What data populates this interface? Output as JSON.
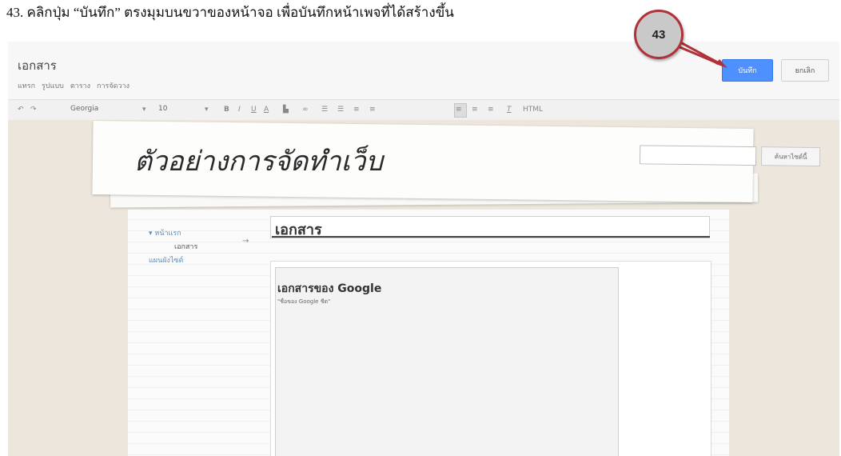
{
  "instruction": "43. คลิกปุ่ม “บันทึก” ตรงมุมบนขวาของหน้าจอ เพื่อบันทึกหน้าเพจที่ได้สร้างขึ้น",
  "callout": {
    "label": "43",
    "color": "#b1313a"
  },
  "editor": {
    "document_title": "เอกสาร",
    "menu": [
      "แทรก",
      "รูปแบบ",
      "ตาราง",
      "การจัดวาง"
    ],
    "save_label": "บันทึก",
    "cancel_label": "ยกเลิก",
    "toolbar": {
      "font": "Georgia",
      "size": "10",
      "more": "HTML"
    },
    "accent_color": "#4d90fe"
  },
  "site": {
    "title": "ตัวอย่างการจัดทำเว็บ",
    "search_button": "ค้นหาไซต์นี้",
    "nav": {
      "home": "หน้าแรก",
      "document": "เอกสาร",
      "sitemap": "แผนผังไซต์"
    }
  },
  "page": {
    "title": "เอกสาร",
    "gadget_title": "เอกสารของ Google",
    "gadget_subtitle": "\"ชื่อของ Google ชีต\""
  }
}
